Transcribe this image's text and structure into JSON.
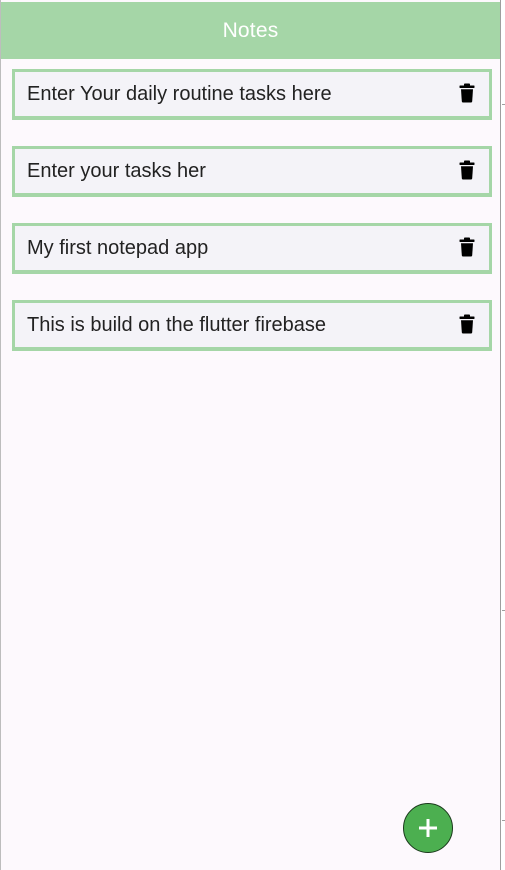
{
  "appbar": {
    "title": "Notes",
    "color": "#a5d6a7"
  },
  "notes": [
    {
      "text": "Enter Your daily routine tasks here",
      "action_icon": "trash-icon"
    },
    {
      "text": "Enter your tasks her",
      "action_icon": "trash-icon"
    },
    {
      "text": "My first notepad app",
      "action_icon": "trash-icon"
    },
    {
      "text": "This is build on the flutter firebase",
      "action_icon": "trash-icon"
    }
  ],
  "fab": {
    "icon": "plus-icon",
    "color": "#4caf50"
  },
  "colors": {
    "card_border": "#a5d6a7",
    "card_background": "#f4f3f8",
    "page_background": "#fdf9fd"
  }
}
